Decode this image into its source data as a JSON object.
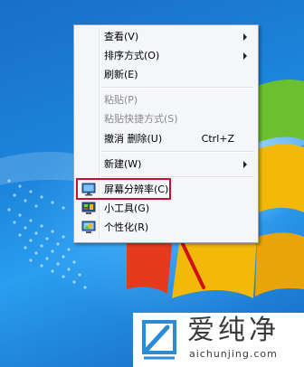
{
  "context_menu": {
    "items": [
      {
        "label": "查看(V)",
        "has_submenu": true
      },
      {
        "label": "排序方式(O)",
        "has_submenu": true
      },
      {
        "label": "刷新(E)"
      },
      {
        "label": "粘贴(P)",
        "disabled": true
      },
      {
        "label": "粘贴快捷方式(S)",
        "disabled": true
      },
      {
        "label": "撤消 删除(U)",
        "shortcut": "Ctrl+Z"
      },
      {
        "label": "新建(W)",
        "has_submenu": true
      },
      {
        "label": "屏幕分辨率(C)",
        "icon": "display-settings-icon",
        "highlighted": true
      },
      {
        "label": "小工具(G)",
        "icon": "gadgets-icon"
      },
      {
        "label": "个性化(R)",
        "icon": "personalize-icon"
      }
    ]
  },
  "annotation": {
    "highlight_color": "#c8102e"
  },
  "watermark": {
    "title": "爱纯净",
    "url": "aichunjing.com"
  },
  "colors": {
    "desktop": "#1c86dc",
    "menu_bg": "#f4f6f9",
    "logo": "#2a8bd6"
  }
}
